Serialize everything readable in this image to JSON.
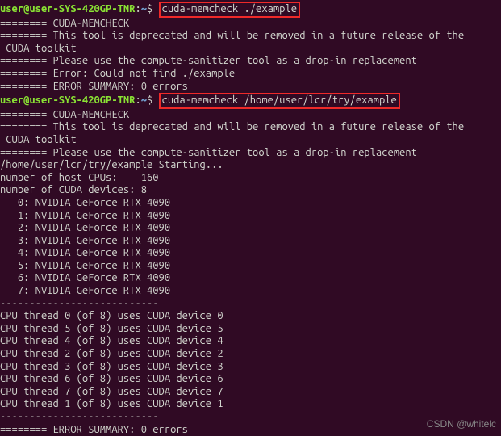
{
  "prompt1": {
    "user": "user@user-SYS-420GP-TNR",
    "sep": ":",
    "path": "~",
    "symbol": "$ ",
    "command": "cuda-memcheck ./example"
  },
  "block1": {
    "l1": "======== CUDA-MEMCHECK",
    "l2": "======== This tool is deprecated and will be removed in a future release of the",
    "l3": " CUDA toolkit",
    "l4": "======== Please use the compute-sanitizer tool as a drop-in replacement",
    "l5": "======== Error: Could not find ./example",
    "l6": "======== ERROR SUMMARY: 0 errors"
  },
  "prompt2": {
    "user": "user@user-SYS-420GP-TNR",
    "sep": ":",
    "path": "~",
    "symbol": "$ ",
    "command": "cuda-memcheck /home/user/lcr/try/example"
  },
  "block2": {
    "l1": "======== CUDA-MEMCHECK",
    "l2": "======== This tool is deprecated and will be removed in a future release of the",
    "l3": " CUDA toolkit",
    "l4": "======== Please use the compute-sanitizer tool as a drop-in replacement",
    "l5": "/home/user/lcr/try/example Starting...",
    "blank1": "",
    "l6": "number of host CPUs:    160",
    "l7": "number of CUDA devices: 8",
    "d0": "   0: NVIDIA GeForce RTX 4090",
    "d1": "   1: NVIDIA GeForce RTX 4090",
    "d2": "   2: NVIDIA GeForce RTX 4090",
    "d3": "   3: NVIDIA GeForce RTX 4090",
    "d4": "   4: NVIDIA GeForce RTX 4090",
    "d5": "   5: NVIDIA GeForce RTX 4090",
    "d6": "   6: NVIDIA GeForce RTX 4090",
    "d7": "   7: NVIDIA GeForce RTX 4090",
    "sep1": "---------------------------",
    "t0": "CPU thread 0 (of 8) uses CUDA device 0",
    "t5": "CPU thread 5 (of 8) uses CUDA device 5",
    "t4": "CPU thread 4 (of 8) uses CUDA device 4",
    "t2": "CPU thread 2 (of 8) uses CUDA device 2",
    "t3": "CPU thread 3 (of 8) uses CUDA device 3",
    "t6": "CPU thread 6 (of 8) uses CUDA device 6",
    "t7": "CPU thread 7 (of 8) uses CUDA device 7",
    "t1": "CPU thread 1 (of 8) uses CUDA device 1",
    "sep2": "---------------------------",
    "sum": "======== ERROR SUMMARY: 0 errors"
  },
  "watermark": "CSDN @whitelc"
}
